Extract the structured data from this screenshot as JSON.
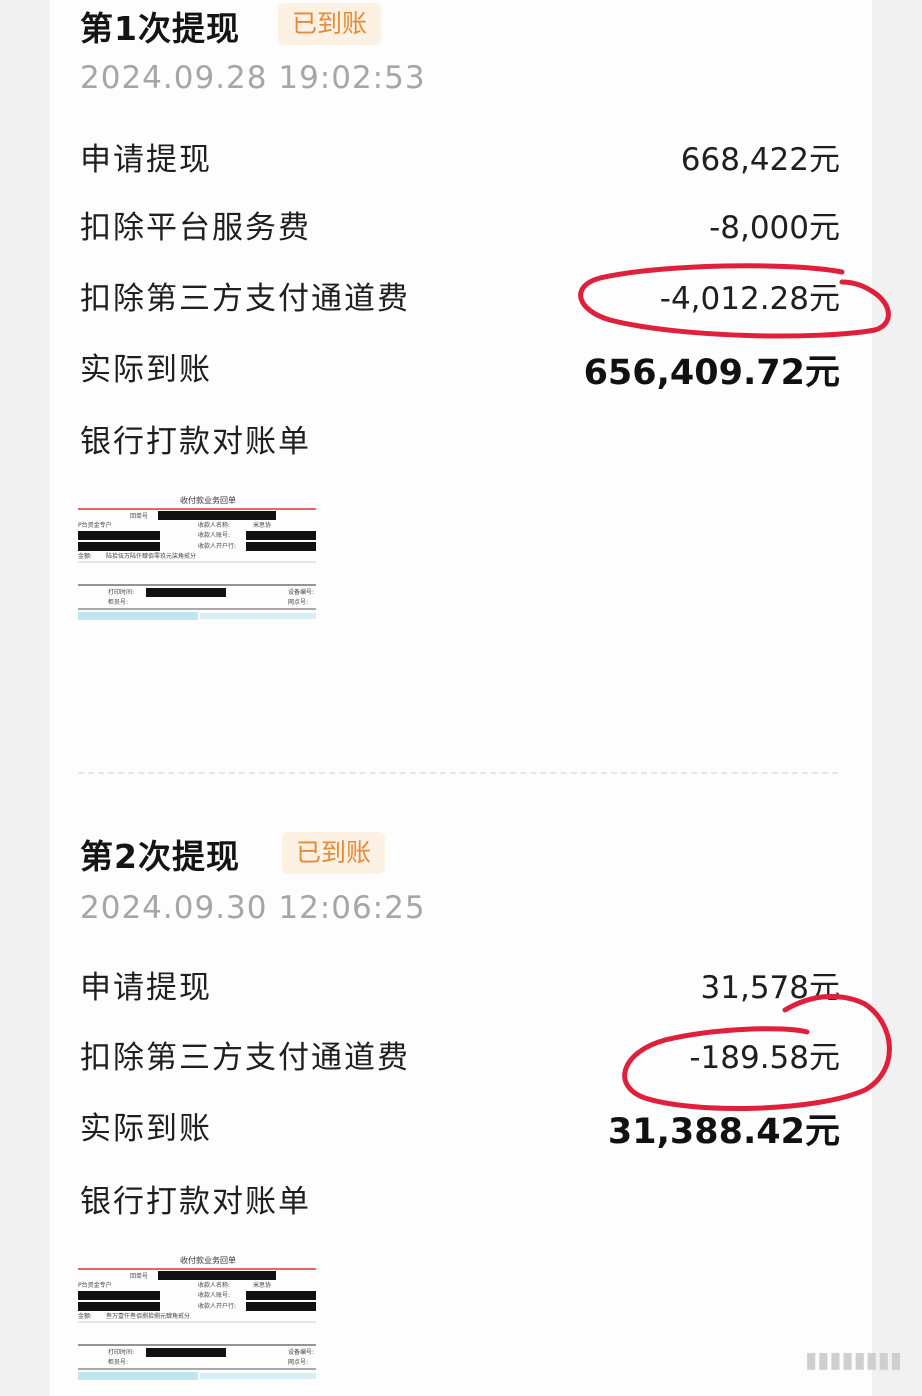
{
  "withdrawals": [
    {
      "title": "第1次提现",
      "status": "已到账",
      "datetime": "2024.09.28 19:02:53",
      "rows": [
        {
          "label": "申请提现",
          "value": "668,422元"
        },
        {
          "label": "扣除平台服务费",
          "value": "-8,000元"
        },
        {
          "label": "扣除第三方支付通道费",
          "value": "-4,012.28元"
        },
        {
          "label": "实际到账",
          "value": "656,409.72元"
        }
      ],
      "statement_label": "银行打款对账单",
      "receipt": {
        "heading": "收付款业务回单",
        "fields": [
          "回单号",
          "收款人名称:",
          "收款人账号:",
          "收款人开户行:",
          "金额:",
          "打印时间:",
          "柜员号:",
          "设备编号:",
          "网点号:"
        ],
        "payee": "米思协",
        "payer_tag": "P台资金专户",
        "amount_words": "陆拾伍万陆仟肆佰零玖元柒角贰分"
      }
    },
    {
      "title": "第2次提现",
      "status": "已到账",
      "datetime": "2024.09.30 12:06:25",
      "rows": [
        {
          "label": "申请提现",
          "value": "31,578元"
        },
        {
          "label": "扣除第三方支付通道费",
          "value": "-189.58元"
        },
        {
          "label": "实际到账",
          "value": "31,388.42元"
        }
      ],
      "statement_label": "银行打款对账单",
      "receipt": {
        "heading": "收付款业务回单",
        "fields": [
          "回单号",
          "收款人名称:",
          "收款人账号:",
          "收款人开户行:",
          "金额:",
          "打印时间:",
          "柜员号:",
          "设备编号:",
          "网点号:"
        ],
        "payee": "米思协",
        "payer_tag": "P台资金专户",
        "amount_words": "叁万壹仟叁佰捌拾捌元肆角贰分"
      }
    }
  ],
  "watermark": "▮▮▮▮▮▮▮▮",
  "colors": {
    "badge_bg": "#fdf1e4",
    "badge_text": "#e58a35",
    "annotation": "#e0203a"
  }
}
